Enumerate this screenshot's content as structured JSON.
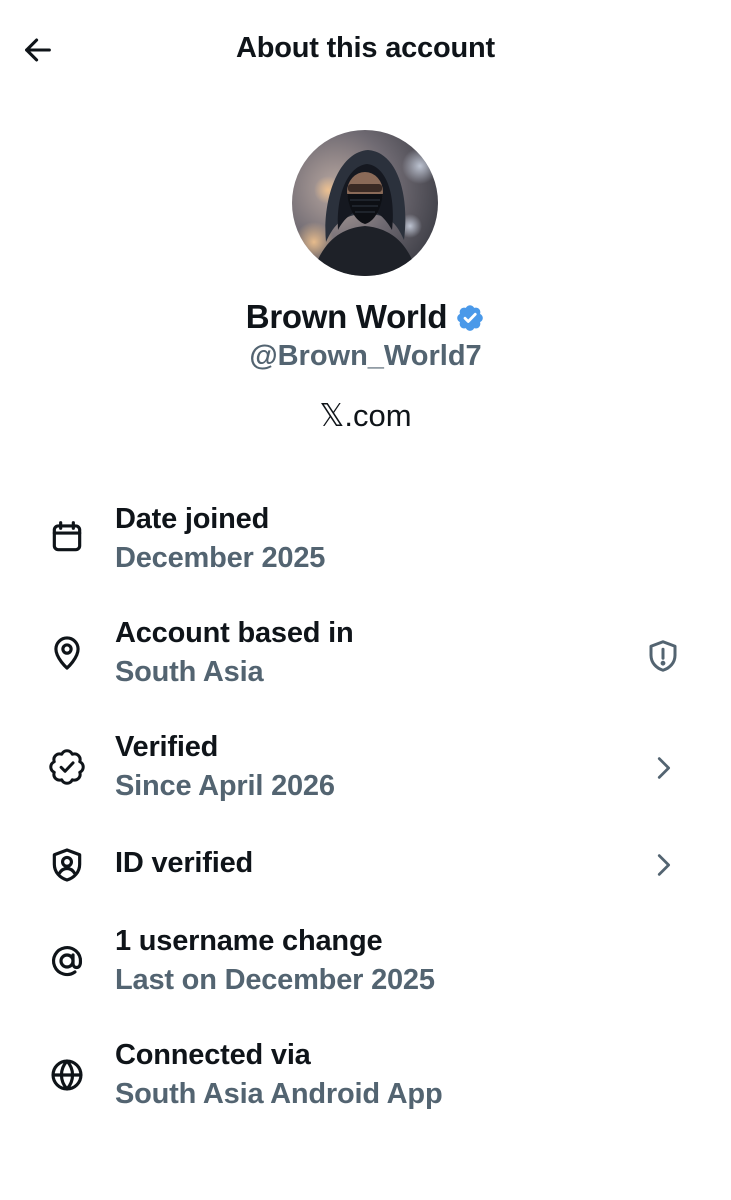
{
  "header": {
    "title": "About this account",
    "back_icon": "arrow-left-icon"
  },
  "profile": {
    "display_name": "Brown World",
    "handle": "@Brown_World7",
    "site_mark": "𝕏",
    "site_suffix": ".com",
    "verified_badge_color": "#4a99e9"
  },
  "details": [
    {
      "icon": "calendar-icon",
      "label": "Date joined",
      "value": "December 2025"
    },
    {
      "icon": "location-pin-icon",
      "label": "Account based in",
      "value": "South Asia",
      "right_icon": "shield-alert-icon"
    },
    {
      "icon": "verified-badge-outline-icon",
      "label": "Verified",
      "value": "Since April 2026",
      "right_icon": "chevron-right-icon"
    },
    {
      "icon": "id-shield-icon",
      "label": "ID verified",
      "right_icon": "chevron-right-icon"
    },
    {
      "icon": "at-sign-icon",
      "label": "1 username change",
      "value": "Last on December 2025"
    },
    {
      "icon": "globe-icon",
      "label": "Connected via",
      "value": "South Asia Android App"
    }
  ],
  "colors": {
    "primary_text": "#0f1419",
    "secondary_text": "#536471",
    "background": "#ffffff"
  }
}
